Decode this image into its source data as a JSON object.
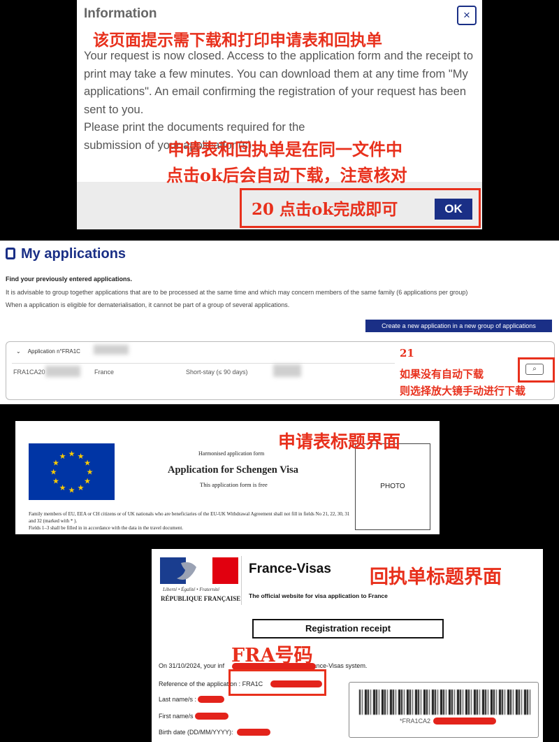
{
  "dialog": {
    "title": "Information",
    "close_glyph": "×",
    "paragraph1": "Your request is now closed. Access to the application form and the receipt to print may take a few minutes. You can download them at any time from \"My applications\". An email confirming the registration of your request has been sent to you.",
    "paragraph2": "Please print the documents required for the submission of your application(s)",
    "ok_label": "OK",
    "annotation_top": "该页面提示需下载和打印申请表和回执单",
    "annotation_mid1": "申请表和回执单是在同一文件中",
    "annotation_mid2": "点击ok后会自动下载，注意核对",
    "annotation_step": "20  点击ok完成即可"
  },
  "applications": {
    "title": "My applications",
    "subtitle": "Find your previously entered applications.",
    "line1": "It is advisable to group together applications that are to be processed at the same time and which may concern members of the same family (6 applications per group)",
    "line2": "When a application is eligible for dematerialisation, it cannot be part of a group of several applications.",
    "create_button": "Create a new application in a new group of applications",
    "group_header": "Application n°FRA1C",
    "row": {
      "ref": "FRA1CA20",
      "country": "France",
      "type": "Short-stay (≤ 90 days)"
    },
    "search_glyph": "🔍",
    "annotation_step": "21",
    "annotation_line1": "如果没有自动下载",
    "annotation_line2": "则选择放大镜手动进行下载"
  },
  "schengen": {
    "harmonised": "Harmonised application form",
    "title": "Application for Schengen Visa",
    "free": "This application form is free",
    "photo": "PHOTO",
    "note1": "Family members of EU, EEA or CH citizens or of UK nationals who are beneficiaries of the EU-UK Withdrawal Agreement shall not fill in fields No 21, 22, 30, 31 and 32 (marked with * ).",
    "note2": "Fields 1–3 shall be filled in in accordance with the data in the travel document.",
    "annotation": "申请表标题界面"
  },
  "receipt": {
    "motto": "Liberté • Égalité • Fraternité",
    "republic": "RÉPUBLIQUE FRANÇAISE",
    "brand": "France-Visas",
    "tagline": "The official website for visa application to France",
    "heading": "Registration receipt",
    "line_date": "On 31/10/2024, your inf",
    "line_date_end": "France-Visas system.",
    "ref_label": "Reference of the application : FRA1C",
    "lastname_label": "Last name/s :",
    "firstname_label": "First name/s",
    "birth_label": "Birth date (DD/MM/YYYY):",
    "barcode_text": "*FRA1CA2",
    "annotation_title": "回执单标题界面",
    "annotation_fra": "FRA号码"
  },
  "colors": {
    "navy": "#1a2f86",
    "annotation_red": "#e8301c",
    "eu_blue": "#0035a5",
    "eu_gold": "#ffcc00"
  }
}
